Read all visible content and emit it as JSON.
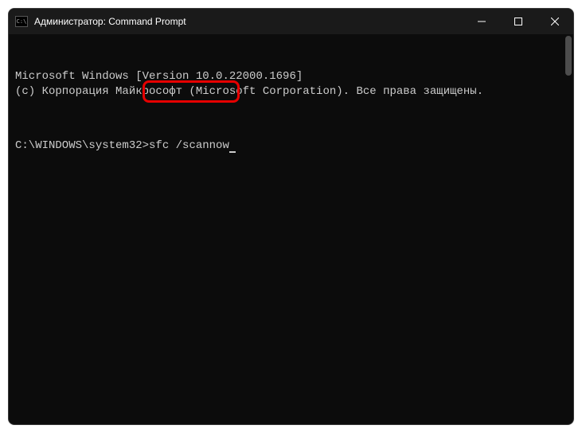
{
  "titlebar": {
    "title": "Администратор: Command Prompt"
  },
  "terminal": {
    "line1": "Microsoft Windows [Version 10.0.22000.1696]",
    "line2": "(c) Корпорация Майкрософт (Microsoft Corporation). Все права защищены.",
    "prompt": "C:\\WINDOWS\\system32>",
    "command": "sfc /scannow"
  }
}
